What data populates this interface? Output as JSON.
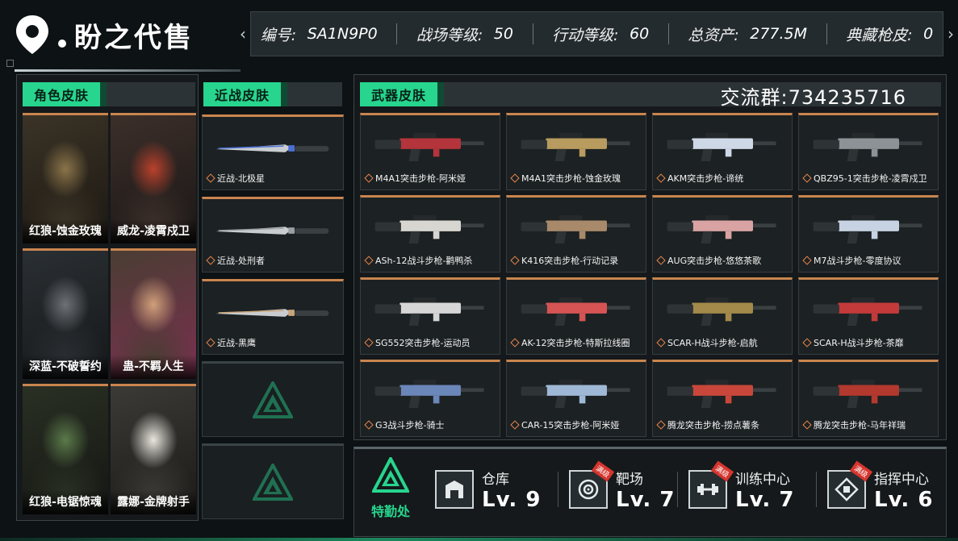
{
  "brand": {
    "title": "盼之代售"
  },
  "stats": [
    {
      "label": "编号:",
      "value": "SA1N9P0"
    },
    {
      "label": "战场等级:",
      "value": "50"
    },
    {
      "label": "行动等级:",
      "value": "60"
    },
    {
      "label": "总资产:",
      "value": "277.5M"
    },
    {
      "label": "典藏枪皮:",
      "value": "0"
    }
  ],
  "sections": {
    "characters": "角色皮肤",
    "melee": "近战皮肤",
    "weapons": "武器皮肤"
  },
  "qq_group": "交流群:734235716",
  "characters": [
    {
      "name": "红狼-蚀金玫瑰",
      "palette": [
        "#3b3326",
        "#8a7449",
        "#1b1712"
      ]
    },
    {
      "name": "威龙-凌霄戍卫",
      "palette": [
        "#3c2f2a",
        "#b9412c",
        "#1a1615"
      ]
    },
    {
      "name": "深蓝-不破誓约",
      "palette": [
        "#2a2f33",
        "#6e7276",
        "#151819"
      ]
    },
    {
      "name": "蛊-不羁人生",
      "palette": [
        "#4a3d33",
        "#d0a07a",
        "#7a3050"
      ]
    },
    {
      "name": "红狼-电锯惊魂",
      "palette": [
        "#2a3024",
        "#5b7a4a",
        "#141612"
      ]
    },
    {
      "name": "露娜-金牌射手",
      "palette": [
        "#3b3a36",
        "#e9e6de",
        "#1b1a18"
      ]
    }
  ],
  "melee": [
    {
      "name": "近战-北极星",
      "accent": "#4b6fd6",
      "empty": false
    },
    {
      "name": "近战-处刑者",
      "accent": "#9aa0a3",
      "empty": false
    },
    {
      "name": "近战-黑鹰",
      "accent": "#c9a67a",
      "empty": false
    },
    {
      "name": "",
      "accent": "",
      "empty": true
    },
    {
      "name": "",
      "accent": "",
      "empty": true
    }
  ],
  "weapons": [
    {
      "name": "M4A1突击步枪-阿米娅",
      "color": "#b3343a"
    },
    {
      "name": "M4A1突击步枪-蚀金玫瑰",
      "color": "#b89b5e"
    },
    {
      "name": "AKM突击步枪-谛统",
      "color": "#cfd8e6"
    },
    {
      "name": "QBZ95-1突击步枪-凌霄戍卫",
      "color": "#8c9296"
    },
    {
      "name": "ASh-12战斗步枪-鹳鸭杀",
      "color": "#d8d6d0"
    },
    {
      "name": "K416突击步枪-行动记录",
      "color": "#a8896a"
    },
    {
      "name": "AUG突击步枪-悠悠茶歌",
      "color": "#d9a3a3"
    },
    {
      "name": "M7战斗步枪-零度协议",
      "color": "#c7d3e3"
    },
    {
      "name": "SG552突击步枪-运动员",
      "color": "#d6d6d6"
    },
    {
      "name": "AK-12突击步枪-特斯拉线圈",
      "color": "#d65454"
    },
    {
      "name": "SCAR-H战斗步枪-启航",
      "color": "#a38a4a"
    },
    {
      "name": "SCAR-H战斗步枪-茶靡",
      "color": "#c43a3a"
    },
    {
      "name": "G3战斗步枪-骑士",
      "color": "#6b86b8"
    },
    {
      "name": "CAR-15突击步枪-阿米娅",
      "color": "#9fb8d6"
    },
    {
      "name": "腾龙突击步枪-捞点薯条",
      "color": "#c9473a"
    },
    {
      "name": "腾龙突击步枪-马年祥瑞",
      "color": "#b3382e"
    }
  ],
  "special": {
    "label": "特勤处"
  },
  "facilities": [
    {
      "name": "仓库",
      "level": "Lv. 9",
      "icon": "warehouse-icon",
      "tag": ""
    },
    {
      "name": "靶场",
      "level": "Lv. 7",
      "icon": "target-icon",
      "tag": "满级"
    },
    {
      "name": "训练中心",
      "level": "Lv. 7",
      "icon": "dumbbell-icon",
      "tag": "满级"
    },
    {
      "name": "指挥中心",
      "level": "Lv. 6",
      "icon": "command-icon",
      "tag": "满级"
    }
  ],
  "accent": "#27d58e",
  "card_border": "#c9854f"
}
